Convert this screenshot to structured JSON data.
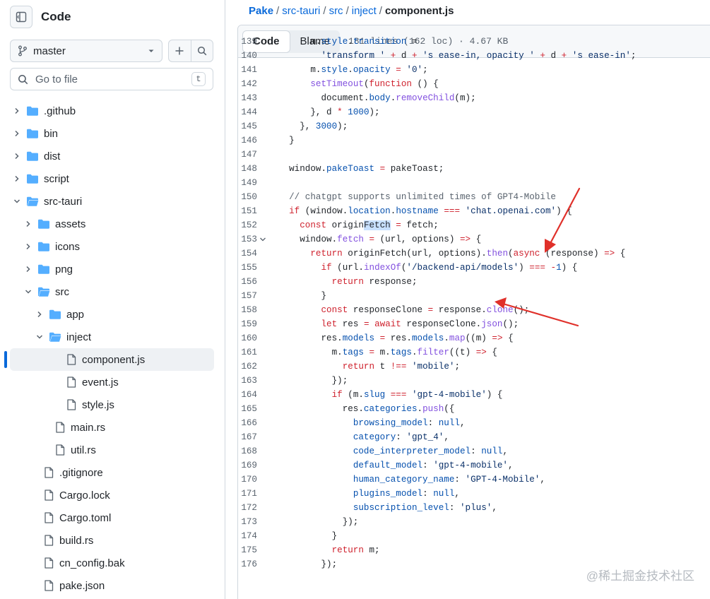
{
  "sidebar": {
    "title": "Code",
    "branch": "master",
    "goto_placeholder": "Go to file",
    "goto_shortcut": "t",
    "tree": [
      {
        "name": ".github",
        "type": "folder",
        "depth": 0,
        "expanded": false
      },
      {
        "name": "bin",
        "type": "folder",
        "depth": 0,
        "expanded": false
      },
      {
        "name": "dist",
        "type": "folder",
        "depth": 0,
        "expanded": false
      },
      {
        "name": "script",
        "type": "folder",
        "depth": 0,
        "expanded": false
      },
      {
        "name": "src-tauri",
        "type": "folder",
        "depth": 0,
        "expanded": true
      },
      {
        "name": "assets",
        "type": "folder",
        "depth": 1,
        "expanded": false
      },
      {
        "name": "icons",
        "type": "folder",
        "depth": 1,
        "expanded": false
      },
      {
        "name": "png",
        "type": "folder",
        "depth": 1,
        "expanded": false
      },
      {
        "name": "src",
        "type": "folder",
        "depth": 1,
        "expanded": true
      },
      {
        "name": "app",
        "type": "folder",
        "depth": 2,
        "expanded": false
      },
      {
        "name": "inject",
        "type": "folder",
        "depth": 2,
        "expanded": true
      },
      {
        "name": "component.js",
        "type": "file",
        "depth": 3,
        "selected": true
      },
      {
        "name": "event.js",
        "type": "file",
        "depth": 3
      },
      {
        "name": "style.js",
        "type": "file",
        "depth": 3
      },
      {
        "name": "main.rs",
        "type": "file",
        "depth": 2
      },
      {
        "name": "util.rs",
        "type": "file",
        "depth": 2
      },
      {
        "name": ".gitignore",
        "type": "file",
        "depth": 1
      },
      {
        "name": "Cargo.lock",
        "type": "file",
        "depth": 1
      },
      {
        "name": "Cargo.toml",
        "type": "file",
        "depth": 1
      },
      {
        "name": "build.rs",
        "type": "file",
        "depth": 1
      },
      {
        "name": "cn_config.bak",
        "type": "file",
        "depth": 1
      },
      {
        "name": "pake.json",
        "type": "file",
        "depth": 1
      }
    ]
  },
  "breadcrumb": {
    "parts": [
      "Pake",
      "src-tauri",
      "src",
      "inject"
    ],
    "current": "component.js",
    "separator": "/"
  },
  "file": {
    "tab_code": "Code",
    "tab_blame": "Blame",
    "info": "181 lines (162 loc) · 4.67 KB"
  },
  "code_lines": [
    {
      "n": 139,
      "t": [
        [
          "",
          "      m."
        ],
        [
          "p",
          "style"
        ],
        [
          "",
          "."
        ],
        [
          "p",
          "transition"
        ],
        [
          "",
          " ="
        ]
      ]
    },
    {
      "n": 140,
      "t": [
        [
          "",
          "        "
        ],
        [
          "s",
          "'transform '"
        ],
        [
          "",
          " "
        ],
        [
          "k",
          "+"
        ],
        [
          "",
          " d "
        ],
        [
          "k",
          "+"
        ],
        [
          "",
          " "
        ],
        [
          "s",
          "'s ease-in, opacity '"
        ],
        [
          "",
          " "
        ],
        [
          "k",
          "+"
        ],
        [
          "",
          " d "
        ],
        [
          "k",
          "+"
        ],
        [
          "",
          " "
        ],
        [
          "s",
          "'s ease-in'"
        ],
        [
          "",
          ";"
        ]
      ]
    },
    {
      "n": 141,
      "t": [
        [
          "",
          "      m."
        ],
        [
          "p",
          "style"
        ],
        [
          "",
          "."
        ],
        [
          "p",
          "opacity"
        ],
        [
          "",
          " "
        ],
        [
          "k",
          "="
        ],
        [
          "",
          " "
        ],
        [
          "s",
          "'0'"
        ],
        [
          "",
          ";"
        ]
      ]
    },
    {
      "n": 142,
      "t": [
        [
          "",
          "      "
        ],
        [
          "f",
          "setTimeout"
        ],
        [
          "",
          "("
        ],
        [
          "k",
          "function"
        ],
        [
          "",
          " () {"
        ]
      ]
    },
    {
      "n": 143,
      "t": [
        [
          "",
          "        document."
        ],
        [
          "p",
          "body"
        ],
        [
          "",
          "."
        ],
        [
          "f",
          "removeChild"
        ],
        [
          "",
          "(m);"
        ]
      ]
    },
    {
      "n": 144,
      "t": [
        [
          "",
          "      }, d "
        ],
        [
          "k",
          "*"
        ],
        [
          "",
          " "
        ],
        [
          "p",
          "1000"
        ],
        [
          "",
          ");"
        ]
      ]
    },
    {
      "n": 145,
      "t": [
        [
          "",
          "    }, "
        ],
        [
          "p",
          "3000"
        ],
        [
          "",
          ");"
        ]
      ]
    },
    {
      "n": 146,
      "t": [
        [
          "",
          "  }"
        ]
      ]
    },
    {
      "n": 147,
      "t": [
        [
          "",
          ""
        ]
      ]
    },
    {
      "n": 148,
      "t": [
        [
          "",
          "  window."
        ],
        [
          "p",
          "pakeToast"
        ],
        [
          "",
          " "
        ],
        [
          "k",
          "="
        ],
        [
          "",
          " pakeToast;"
        ]
      ]
    },
    {
      "n": 149,
      "t": [
        [
          "",
          ""
        ]
      ]
    },
    {
      "n": 150,
      "t": [
        [
          "c",
          "  // chatgpt supports unlimited times of GPT4-Mobile"
        ]
      ]
    },
    {
      "n": 151,
      "t": [
        [
          "",
          "  "
        ],
        [
          "k",
          "if"
        ],
        [
          "",
          " (window."
        ],
        [
          "p",
          "location"
        ],
        [
          "",
          "."
        ],
        [
          "p",
          "hostname"
        ],
        [
          "",
          " "
        ],
        [
          "k",
          "==="
        ],
        [
          "",
          " "
        ],
        [
          "s",
          "'chat.openai.com'"
        ],
        [
          "",
          ") {"
        ]
      ]
    },
    {
      "n": 152,
      "t": [
        [
          "",
          "    "
        ],
        [
          "k",
          "const"
        ],
        [
          "",
          " origin"
        ],
        [
          "hl",
          "Fetch"
        ],
        [
          "",
          " "
        ],
        [
          "k",
          "="
        ],
        [
          "",
          " fetch;"
        ]
      ]
    },
    {
      "n": 153,
      "fold": true,
      "t": [
        [
          "",
          "    window."
        ],
        [
          "f",
          "fetch"
        ],
        [
          "",
          " "
        ],
        [
          "k",
          "="
        ],
        [
          "",
          " (url, options) "
        ],
        [
          "k",
          "=>"
        ],
        [
          "",
          " {"
        ]
      ]
    },
    {
      "n": 154,
      "t": [
        [
          "",
          "      "
        ],
        [
          "k",
          "return"
        ],
        [
          "",
          " originFetch(url, options)."
        ],
        [
          "f",
          "then"
        ],
        [
          "",
          "("
        ],
        [
          "k",
          "async"
        ],
        [
          "",
          " (response) "
        ],
        [
          "k",
          "=>"
        ],
        [
          "",
          " {"
        ]
      ]
    },
    {
      "n": 155,
      "t": [
        [
          "",
          "        "
        ],
        [
          "k",
          "if"
        ],
        [
          "",
          " (url."
        ],
        [
          "f",
          "indexOf"
        ],
        [
          "",
          "("
        ],
        [
          "s",
          "'/backend-api/models'"
        ],
        [
          "",
          ") "
        ],
        [
          "k",
          "==="
        ],
        [
          "",
          " "
        ],
        [
          "k",
          "-"
        ],
        [
          "p",
          "1"
        ],
        [
          "",
          ") {"
        ]
      ]
    },
    {
      "n": 156,
      "t": [
        [
          "",
          "          "
        ],
        [
          "k",
          "return"
        ],
        [
          "",
          " response;"
        ]
      ]
    },
    {
      "n": 157,
      "t": [
        [
          "",
          "        }"
        ]
      ]
    },
    {
      "n": 158,
      "t": [
        [
          "",
          "        "
        ],
        [
          "k",
          "const"
        ],
        [
          "",
          " responseClone "
        ],
        [
          "k",
          "="
        ],
        [
          "",
          " response."
        ],
        [
          "f",
          "clone"
        ],
        [
          "",
          "();"
        ]
      ]
    },
    {
      "n": 159,
      "t": [
        [
          "",
          "        "
        ],
        [
          "k",
          "let"
        ],
        [
          "",
          " res "
        ],
        [
          "k",
          "="
        ],
        [
          "",
          " "
        ],
        [
          "k",
          "await"
        ],
        [
          "",
          " responseClone."
        ],
        [
          "f",
          "json"
        ],
        [
          "",
          "();"
        ]
      ]
    },
    {
      "n": 160,
      "t": [
        [
          "",
          "        res."
        ],
        [
          "p",
          "models"
        ],
        [
          "",
          " "
        ],
        [
          "k",
          "="
        ],
        [
          "",
          " res."
        ],
        [
          "p",
          "models"
        ],
        [
          "",
          "."
        ],
        [
          "f",
          "map"
        ],
        [
          "",
          "((m) "
        ],
        [
          "k",
          "=>"
        ],
        [
          "",
          " {"
        ]
      ]
    },
    {
      "n": 161,
      "t": [
        [
          "",
          "          m."
        ],
        [
          "p",
          "tags"
        ],
        [
          "",
          " "
        ],
        [
          "k",
          "="
        ],
        [
          "",
          " m."
        ],
        [
          "p",
          "tags"
        ],
        [
          "",
          "."
        ],
        [
          "f",
          "filter"
        ],
        [
          "",
          "((t) "
        ],
        [
          "k",
          "=>"
        ],
        [
          "",
          " {"
        ]
      ]
    },
    {
      "n": 162,
      "t": [
        [
          "",
          "            "
        ],
        [
          "k",
          "return"
        ],
        [
          "",
          " t "
        ],
        [
          "k",
          "!=="
        ],
        [
          "",
          " "
        ],
        [
          "s",
          "'mobile'"
        ],
        [
          "",
          ";"
        ]
      ]
    },
    {
      "n": 163,
      "t": [
        [
          "",
          "          });"
        ]
      ]
    },
    {
      "n": 164,
      "t": [
        [
          "",
          "          "
        ],
        [
          "k",
          "if"
        ],
        [
          "",
          " (m."
        ],
        [
          "p",
          "slug"
        ],
        [
          "",
          " "
        ],
        [
          "k",
          "==="
        ],
        [
          "",
          " "
        ],
        [
          "s",
          "'gpt-4-mobile'"
        ],
        [
          "",
          ") {"
        ]
      ]
    },
    {
      "n": 165,
      "t": [
        [
          "",
          "            res."
        ],
        [
          "p",
          "categories"
        ],
        [
          "",
          "."
        ],
        [
          "f",
          "push"
        ],
        [
          "",
          "({"
        ]
      ]
    },
    {
      "n": 166,
      "t": [
        [
          "",
          "              "
        ],
        [
          "p",
          "browsing_model"
        ],
        [
          "",
          ": "
        ],
        [
          "p",
          "null"
        ],
        [
          "",
          ","
        ]
      ]
    },
    {
      "n": 167,
      "t": [
        [
          "",
          "              "
        ],
        [
          "p",
          "category"
        ],
        [
          "",
          ": "
        ],
        [
          "s",
          "'gpt_4'"
        ],
        [
          "",
          ","
        ]
      ]
    },
    {
      "n": 168,
      "t": [
        [
          "",
          "              "
        ],
        [
          "p",
          "code_interpreter_model"
        ],
        [
          "",
          ": "
        ],
        [
          "p",
          "null"
        ],
        [
          "",
          ","
        ]
      ]
    },
    {
      "n": 169,
      "t": [
        [
          "",
          "              "
        ],
        [
          "p",
          "default_model"
        ],
        [
          "",
          ": "
        ],
        [
          "s",
          "'gpt-4-mobile'"
        ],
        [
          "",
          ","
        ]
      ]
    },
    {
      "n": 170,
      "t": [
        [
          "",
          "              "
        ],
        [
          "p",
          "human_category_name"
        ],
        [
          "",
          ": "
        ],
        [
          "s",
          "'GPT-4-Mobile'"
        ],
        [
          "",
          ","
        ]
      ]
    },
    {
      "n": 171,
      "t": [
        [
          "",
          "              "
        ],
        [
          "p",
          "plugins_model"
        ],
        [
          "",
          ": "
        ],
        [
          "p",
          "null"
        ],
        [
          "",
          ","
        ]
      ]
    },
    {
      "n": 172,
      "t": [
        [
          "",
          "              "
        ],
        [
          "p",
          "subscription_level"
        ],
        [
          "",
          ": "
        ],
        [
          "s",
          "'plus'"
        ],
        [
          "",
          ","
        ]
      ]
    },
    {
      "n": 173,
      "t": [
        [
          "",
          "            });"
        ]
      ]
    },
    {
      "n": 174,
      "t": [
        [
          "",
          "          }"
        ]
      ]
    },
    {
      "n": 175,
      "t": [
        [
          "",
          "          "
        ],
        [
          "k",
          "return"
        ],
        [
          "",
          " m;"
        ]
      ]
    },
    {
      "n": 176,
      "t": [
        [
          "",
          "        });"
        ]
      ]
    }
  ],
  "watermark": "@稀土掘金技术社区",
  "colors": {
    "accent": "#0969da",
    "folder": "#54aeff",
    "arrow": "#e0302a"
  }
}
